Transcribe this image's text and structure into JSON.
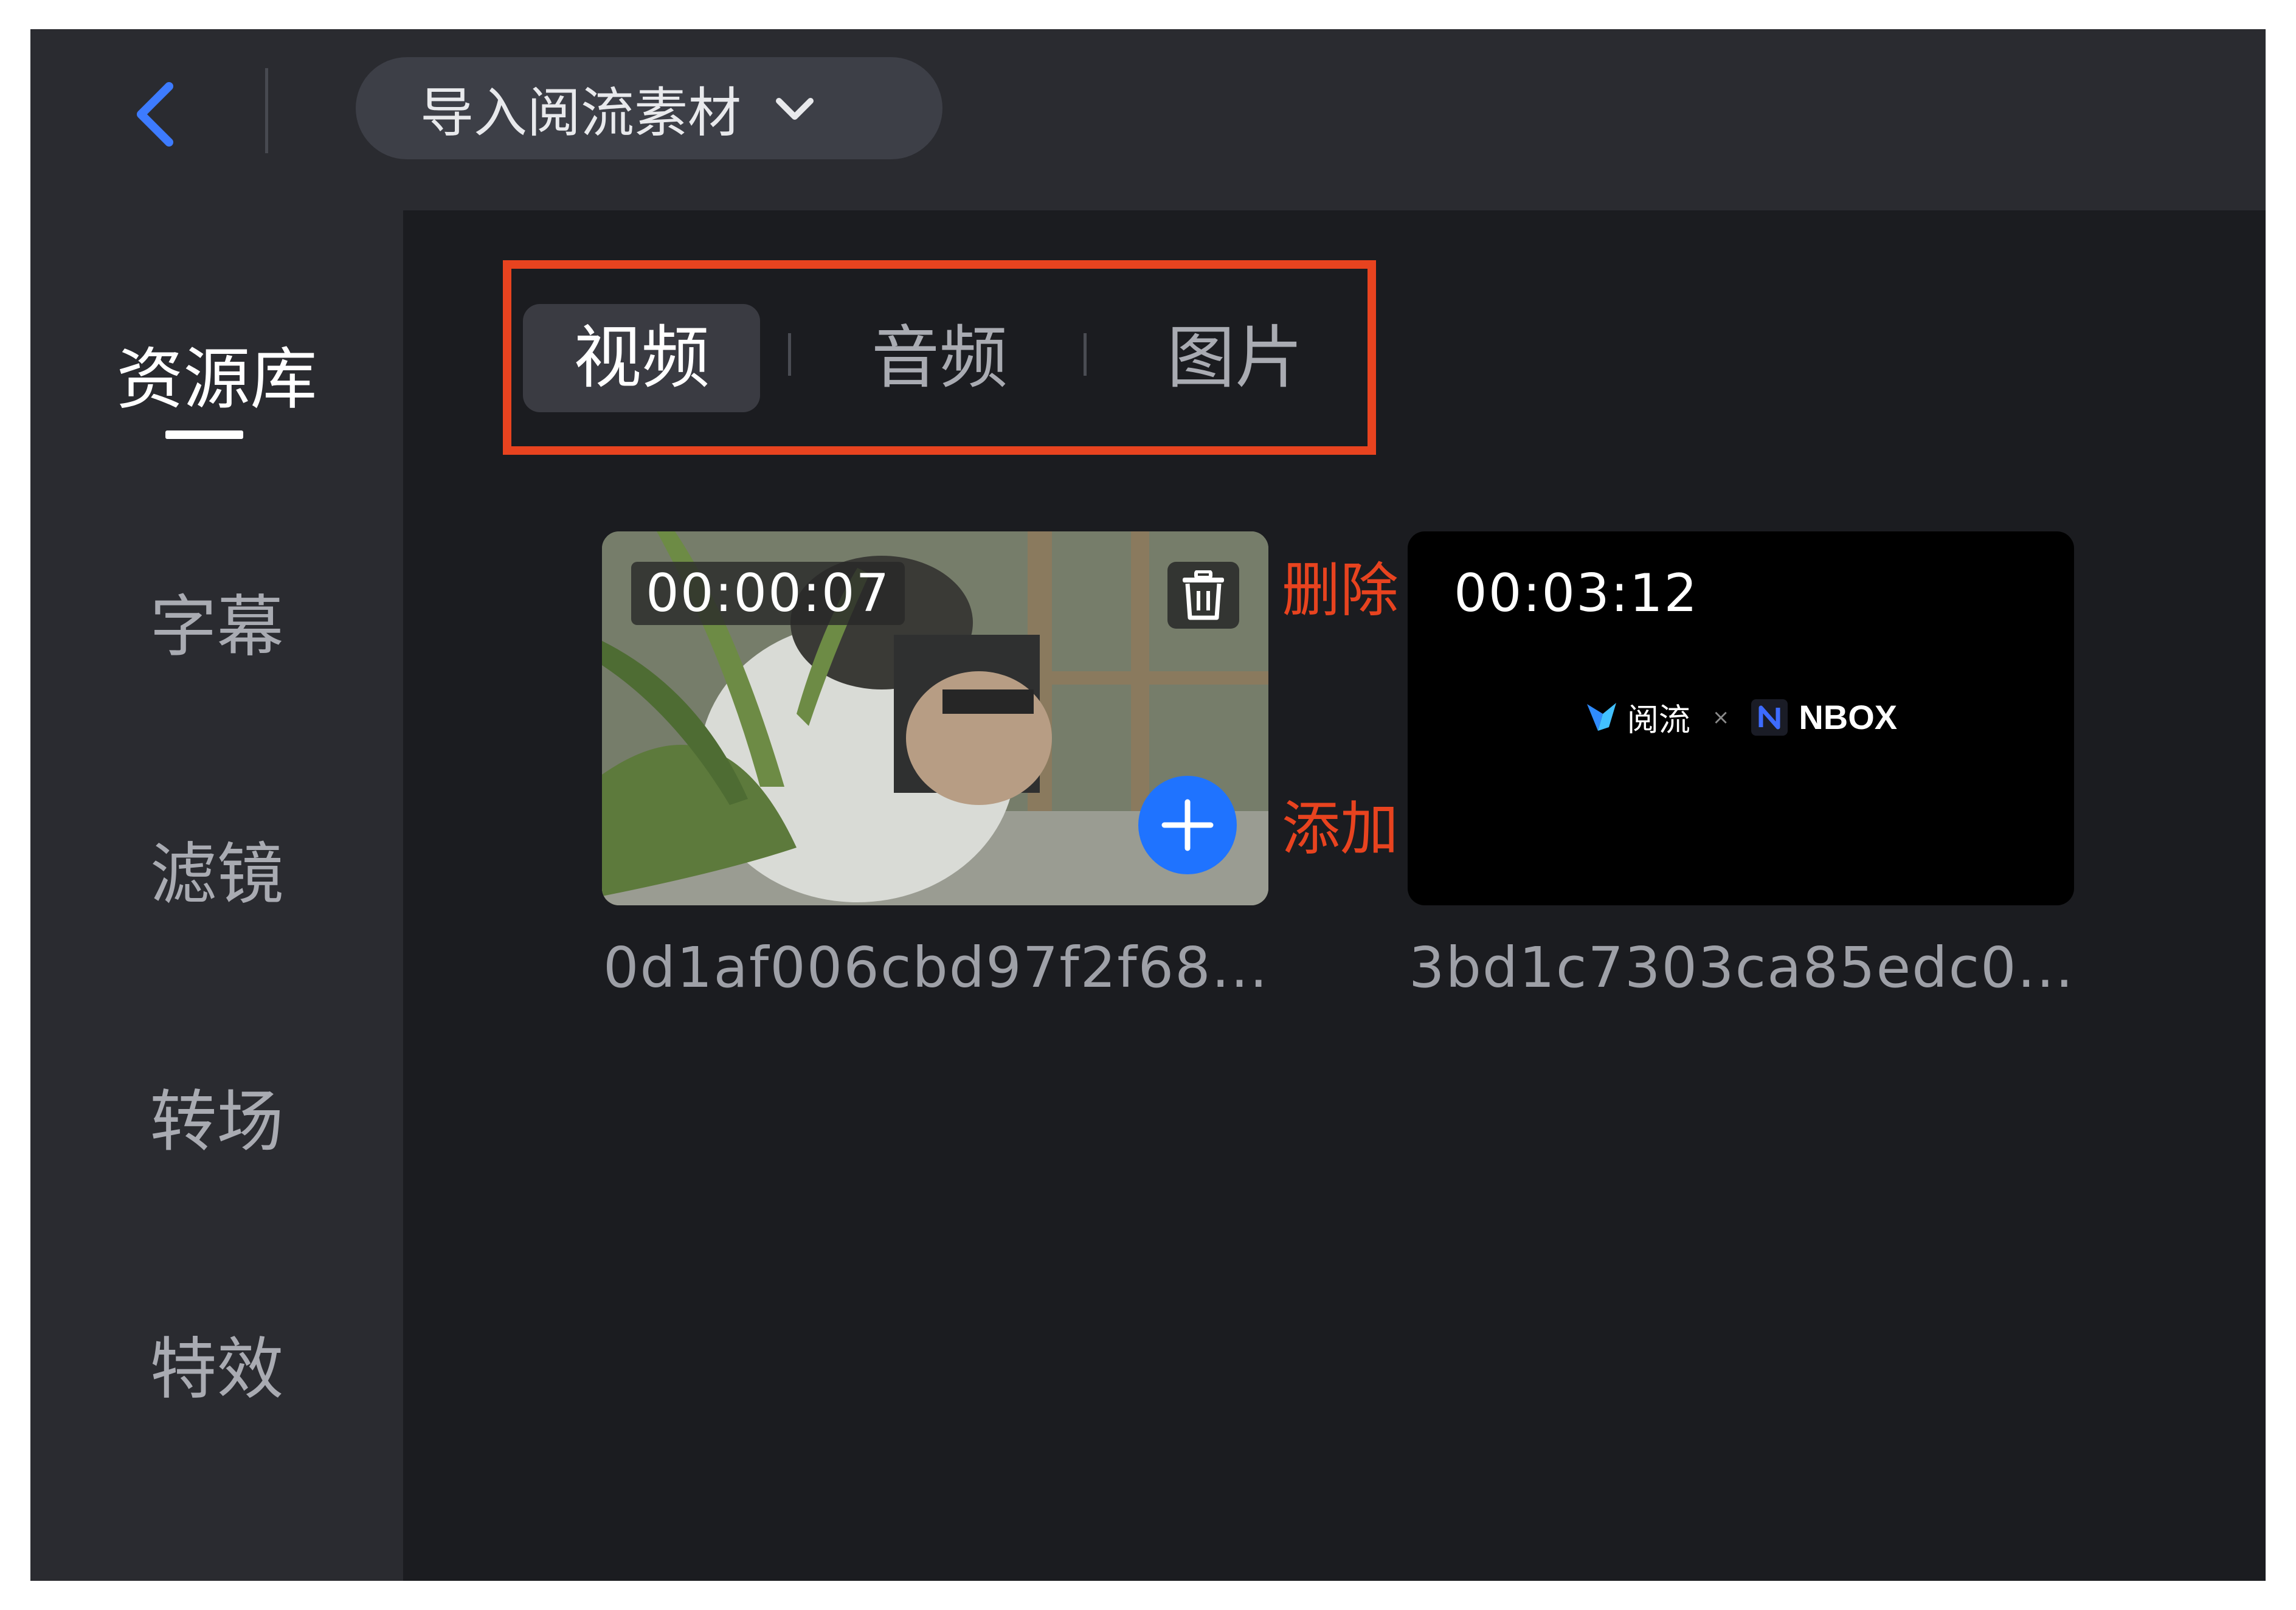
{
  "header": {
    "import_label": "导入阅流素材"
  },
  "sidebar": {
    "items": [
      {
        "label": "资源库",
        "active": true
      },
      {
        "label": "字幕"
      },
      {
        "label": "滤镜"
      },
      {
        "label": "转场"
      },
      {
        "label": "特效"
      }
    ]
  },
  "tabs": [
    {
      "label": "视频",
      "active": true
    },
    {
      "label": "音频"
    },
    {
      "label": "图片"
    }
  ],
  "media": [
    {
      "duration": "00:00:07",
      "filename": "0d1af006cbd97f2f68..."
    },
    {
      "duration": "00:03:12",
      "filename": "3bd1c7303ca85edc0...",
      "logo_text": "阅流",
      "logo_separator": "×",
      "partner_text": "NBOX"
    }
  ],
  "annotations": {
    "delete": "删除",
    "add": "添加"
  },
  "colors": {
    "accent_blue": "#1f73ff",
    "annotation_red": "#e8431f",
    "background": "#1b1c20",
    "panel": "#2a2b30"
  }
}
